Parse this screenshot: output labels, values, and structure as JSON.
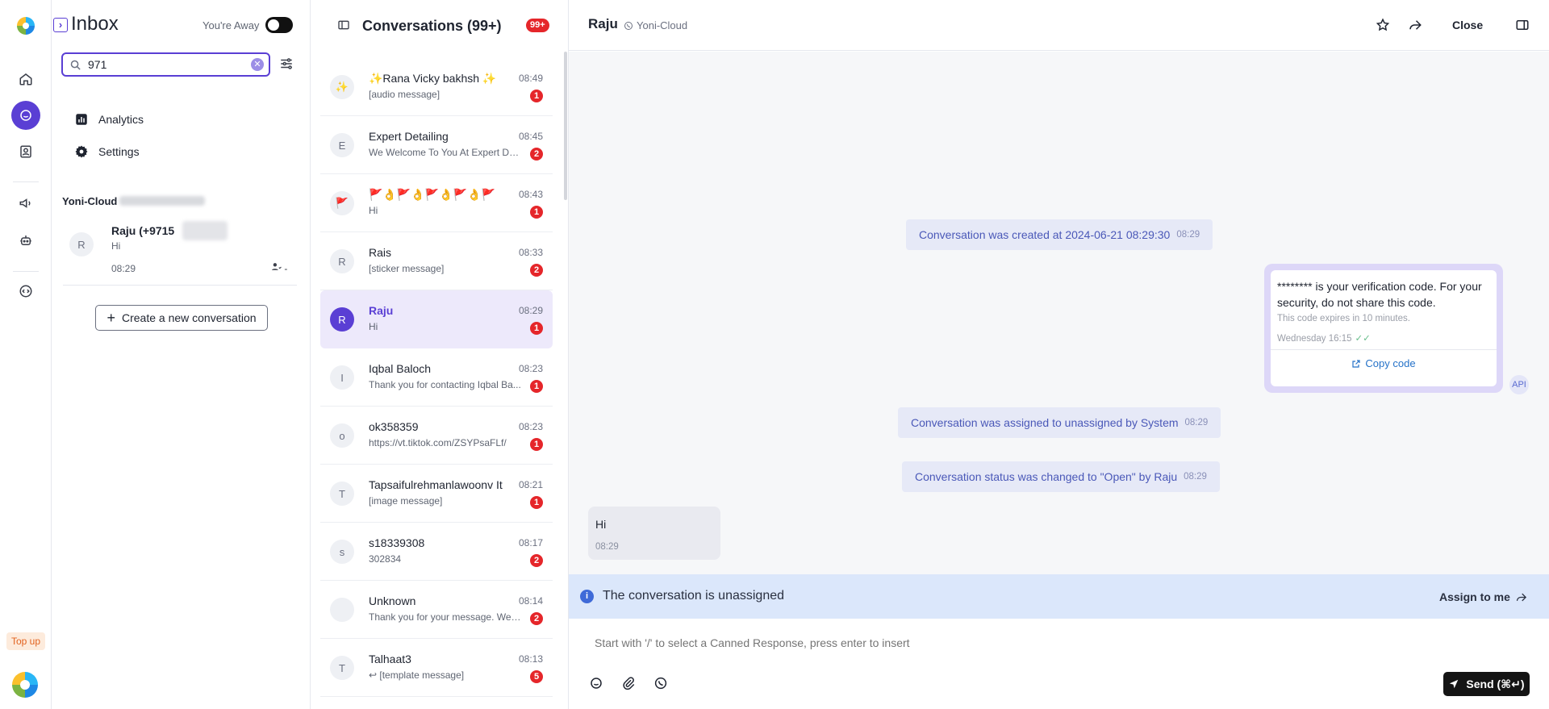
{
  "rail": {
    "icons": [
      "app-logo",
      "home-icon",
      "chat-icon",
      "contacts-icon",
      "campaigns-icon",
      "bot-icon",
      "integrations-icon"
    ],
    "topup_label": "Top up"
  },
  "inbox": {
    "title": "Inbox",
    "away_label": "You're Away",
    "search_value": "971",
    "nav": [
      {
        "label": "Analytics",
        "icon": "analytics-icon"
      },
      {
        "label": "Settings",
        "icon": "gear-icon"
      }
    ],
    "account_label": "Yoni-Cloud",
    "contact": {
      "initial": "R",
      "name": "Raju (+9715",
      "preview": "Hi",
      "time": "08:29",
      "assign_dash": "-"
    },
    "create_label": "Create a new conversation"
  },
  "conversations": {
    "title": "Conversations (99+)",
    "badge": "99+",
    "items": [
      {
        "initial": "✨",
        "name": "✨Rana Vicky bakhsh ✨",
        "preview": "[audio message]",
        "time": "08:49",
        "unread": "1",
        "active": false
      },
      {
        "initial": "E",
        "name": "Expert Detailing",
        "preview": "We Welcome To You At Expert De...",
        "time": "08:45",
        "unread": "2",
        "active": false
      },
      {
        "initial": "🚩",
        "name": "🚩👌🚩👌🚩👌🚩👌🚩",
        "preview": "Hi",
        "time": "08:43",
        "unread": "1",
        "active": false
      },
      {
        "initial": "R",
        "name": "Rais",
        "preview": "[sticker message]",
        "time": "08:33",
        "unread": "2",
        "active": false
      },
      {
        "initial": "R",
        "name": "Raju",
        "preview": "Hi",
        "time": "08:29",
        "unread": "1",
        "active": true
      },
      {
        "initial": "I",
        "name": "Iqbal Baloch",
        "preview": "Thank you for contacting Iqbal Ba...",
        "time": "08:23",
        "unread": "1",
        "active": false
      },
      {
        "initial": "o",
        "name": "ok358359",
        "preview": "https://vt.tiktok.com/ZSYPsaFLf/",
        "time": "08:23",
        "unread": "1",
        "active": false
      },
      {
        "initial": "T",
        "name": "Tapsaifulrehmanlawoonv It",
        "preview": "[image message]",
        "time": "08:21",
        "unread": "1",
        "active": false
      },
      {
        "initial": "s",
        "name": "s18339308",
        "preview": "302834",
        "time": "08:17",
        "unread": "2",
        "active": false
      },
      {
        "initial": "",
        "name": "Unknown",
        "preview": "Thank you for your message. We'r...",
        "time": "08:14",
        "unread": "2",
        "active": false
      },
      {
        "initial": "T",
        "name": "Talhaat3",
        "preview": "↩ [template message]",
        "time": "08:13",
        "unread": "5",
        "active": false
      }
    ]
  },
  "chat": {
    "contact_name": "Raju",
    "channel": "Yoni-Cloud",
    "close_label": "Close",
    "activities": [
      {
        "text": "Conversation was created at 2024-06-21 08:29:30",
        "time": "08:29"
      },
      {
        "text": "Conversation was assigned to unassigned by System",
        "time": "08:29"
      },
      {
        "text": "Conversation status was changed to \"Open\" by Raju",
        "time": "08:29"
      }
    ],
    "otp_message": {
      "text": "******** is your verification code. For your security, do not share this code.",
      "sub": "This code expires in 10 minutes.",
      "stamp": "Wednesday 16:15",
      "copy_label": "Copy code",
      "sender_badge": "API"
    },
    "incoming": {
      "text": "Hi",
      "time": "08:29"
    },
    "unassigned_text": "The conversation is unassigned",
    "assign_label": "Assign to me",
    "reply_placeholder": "Start with '/' to select a Canned Response, press enter to insert",
    "send_label": "Send (⌘↵)"
  },
  "colors": {
    "accent": "#5a3fd4",
    "unread": "#e5262a",
    "banner": "#dbe7fb"
  }
}
